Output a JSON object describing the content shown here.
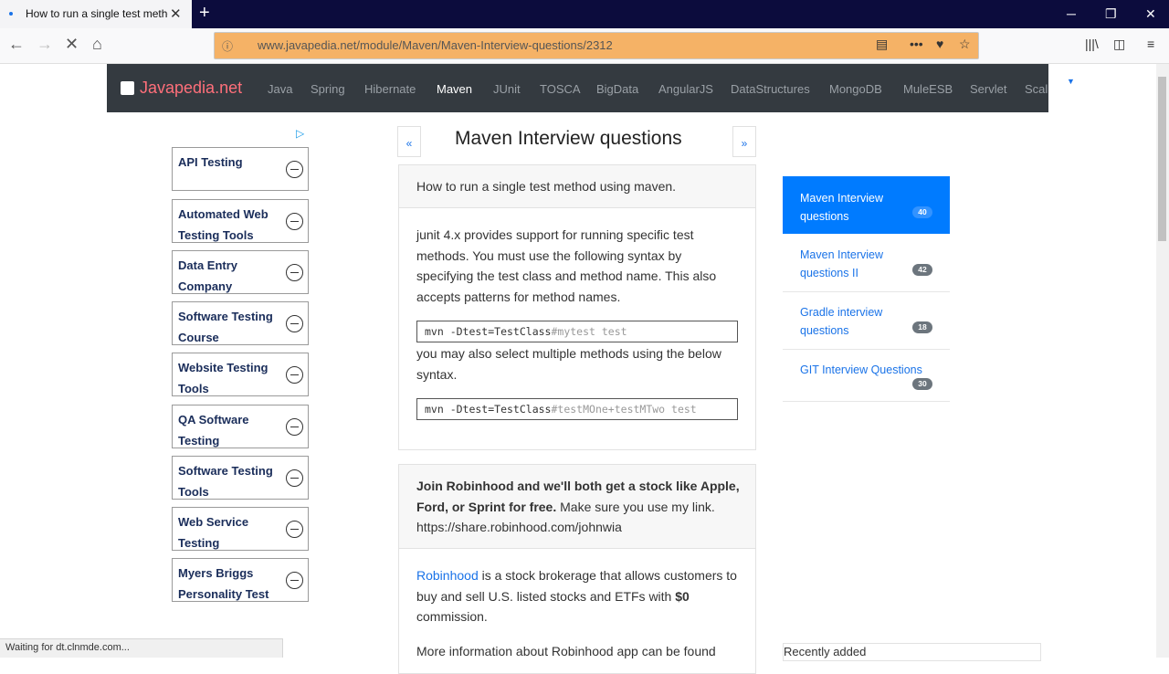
{
  "browser": {
    "tab_title": "How to run a single test method using maven",
    "new_tab_glyph": "+",
    "url": "www.javapedia.net/module/Maven/Maven-Interview-questions/2312",
    "status": "Waiting for dt.clnmde.com..."
  },
  "site": {
    "logo": "Javapedia.net",
    "nav": [
      "Java",
      "Spring",
      "Hibernate",
      "Maven",
      "JUnit",
      "TOSCA",
      "BigData",
      "AngularJS",
      "DataStructures",
      "MongoDB",
      "MuleESB",
      "Servlet",
      "Scala"
    ],
    "active_nav": "Maven"
  },
  "ads": [
    {
      "label": "API Testing"
    },
    {
      "label": "Automated Web Testing Tools"
    },
    {
      "label": "Data Entry Company"
    },
    {
      "label": "Software Testing Course"
    },
    {
      "label": "Website Testing Tools"
    },
    {
      "label": "QA Software Testing"
    },
    {
      "label": "Software Testing Tools"
    },
    {
      "label": "Web Service Testing"
    },
    {
      "label": "Myers Briggs Personality Test"
    }
  ],
  "main": {
    "prev": "«",
    "next": "»",
    "title": "Maven Interview questions",
    "question": "How to run a single test method using maven.",
    "answer_p1": "junit 4.x provides support for running specific test methods. You must use the following syntax by specifying the test class and method name. This also accepts patterns for method names.",
    "code1_cmd": "mvn -Dtest=TestClass",
    "code1_tail": "#mytest test",
    "answer_p2": "you may also select multiple methods using the below syntax.",
    "code2_cmd": "mvn -Dtest=TestClass",
    "code2_tail": "#testMOne+testMTwo test",
    "promo_bold": "Join Robinhood and we'll both get a stock like Apple, Ford, or Sprint for free.",
    "promo_rest": "Make sure you use my link. https://share.robinhood.com/johnwia",
    "rh_link": "Robinhood",
    "rh_text1": "is a stock brokerage that allows customers to buy and sell U.S. listed stocks and ETFs with",
    "rh_bold": "$0",
    "rh_text2": "commission.",
    "more": "More information about Robinhood app can be found"
  },
  "right_list": [
    {
      "label": "Maven Interview questions",
      "count": "40",
      "active": true
    },
    {
      "label": "Maven Interview questions II",
      "count": "42",
      "active": false
    },
    {
      "label": "Gradle interview questions",
      "count": "18",
      "active": false
    },
    {
      "label": "GIT Interview Questions",
      "count": "30",
      "active": false
    }
  ],
  "recently_added": "Recently added",
  "colors": {
    "accent": "#007bff",
    "nav_bg": "#343a40",
    "logo": "#ff6f7a",
    "url_highlight": "#f5b266"
  }
}
